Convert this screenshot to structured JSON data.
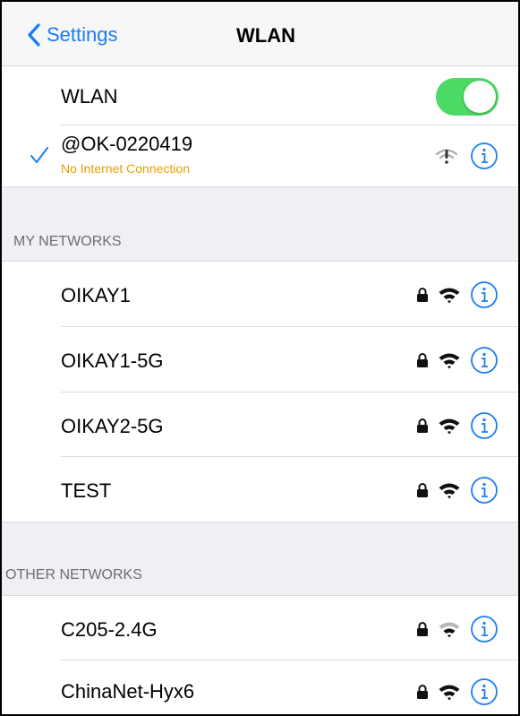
{
  "navbar": {
    "back_label": "Settings",
    "title": "WLAN"
  },
  "wlan_toggle": {
    "label": "WLAN",
    "state": "on"
  },
  "connected": {
    "name": "@OK-0220419",
    "status": "No Internet Connection"
  },
  "sections": {
    "my_networks_header": "MY NETWORKS",
    "other_networks_header": "OTHER NETWORKS"
  },
  "my_networks": [
    {
      "name": "OIKAY1"
    },
    {
      "name": "OIKAY1-5G"
    },
    {
      "name": "OIKAY2-5G"
    },
    {
      "name": "TEST"
    }
  ],
  "other_networks": [
    {
      "name": "C205-2.4G"
    },
    {
      "name": "ChinaNet-Hyx6"
    }
  ],
  "colors": {
    "accent": "#1a7cf5",
    "toggle_on": "#4cd964",
    "warning": "#e8a000",
    "section_bg": "#efeff4"
  },
  "icons": {
    "back": "chevron-left-icon",
    "checkmark": "checkmark-icon",
    "lock": "lock-icon",
    "wifi": "wifi-icon",
    "info": "info-icon",
    "no_internet": "wifi-exclamation-icon"
  }
}
